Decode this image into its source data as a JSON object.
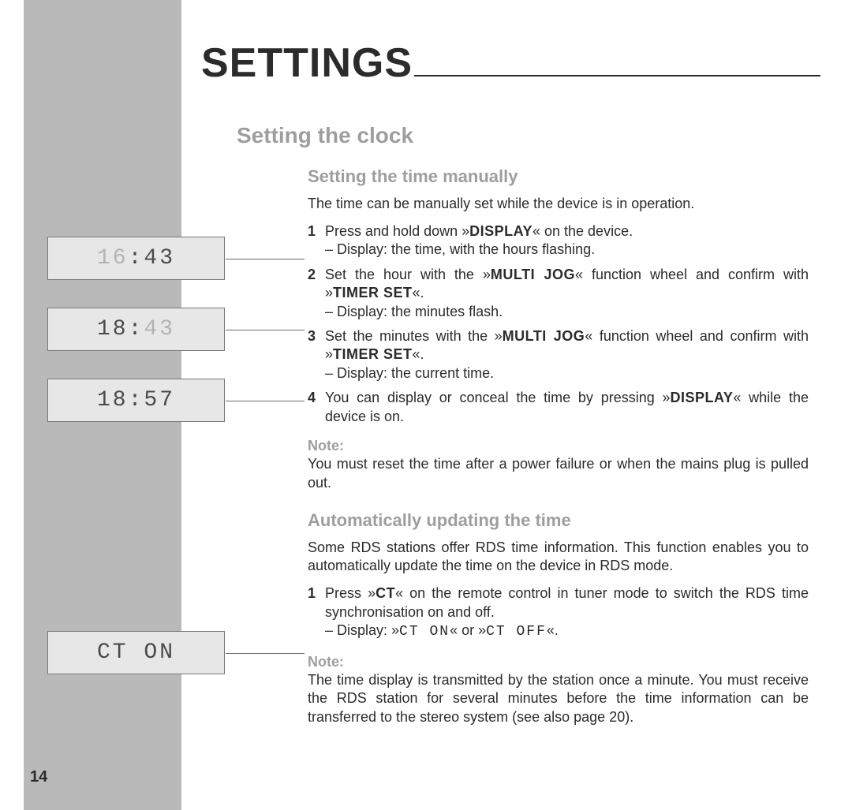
{
  "page_number": "14",
  "title": "SETTINGS",
  "h2_a": "Setting the clock",
  "section_a": {
    "h3": "Setting the time manually",
    "intro": "The time can be manually set while the device is in operation.",
    "steps": {
      "s1_num": "1",
      "s1_a": "Press and hold down »",
      "s1_btn": "DISPLAY",
      "s1_b": "« on the device.",
      "s1_sub": "– Display: the time, with the hours flashing.",
      "s2_num": "2",
      "s2_a": "Set the hour with the »",
      "s2_btn1": "MULTI JOG",
      "s2_b": "« function wheel and confirm with »",
      "s2_btn2": "TIMER SET",
      "s2_c": "«.",
      "s2_sub": "– Display: the minutes flash.",
      "s3_num": "3",
      "s3_a": "Set the minutes with the »",
      "s3_btn1": "MULTI JOG",
      "s3_b": "« function wheel and confirm with »",
      "s3_btn2": "TIMER SET",
      "s3_c": "«.",
      "s3_sub": "– Display: the current time.",
      "s4_num": "4",
      "s4_a": "You can display or conceal the time by pressing »",
      "s4_btn": "DISPLAY",
      "s4_b": "« while the device is on."
    },
    "note_label": "Note:",
    "note_body": "You must reset the time after a power failure or when the mains plug is pulled out."
  },
  "section_b": {
    "h3": "Automatically updating the time",
    "intro": "Some RDS stations offer RDS time information. This function enables you to automatically update the time on the device in RDS mode.",
    "steps": {
      "s1_num": "1",
      "s1_a": "Press »",
      "s1_btn": "CT",
      "s1_b": "« on the remote control in tuner mode to switch the RDS time synchronisation on and off.",
      "s1_sub_a": "– Display: »",
      "s1_sub_seg1": "CT ON",
      "s1_sub_b": "« or »",
      "s1_sub_seg2": "CT OFF",
      "s1_sub_c": "«."
    },
    "note_label": "Note:",
    "note_body": "The time display is transmitted by the station once a minute. You must receive the RDS station for several minutes before the time information can be transferred to the stereo system (see also page 20)."
  },
  "lcd": {
    "d1_a": "16",
    "d1_b": ":43",
    "d2_a": "18:",
    "d2_b": "43",
    "d3": "18:57",
    "d4": "CT ON"
  }
}
